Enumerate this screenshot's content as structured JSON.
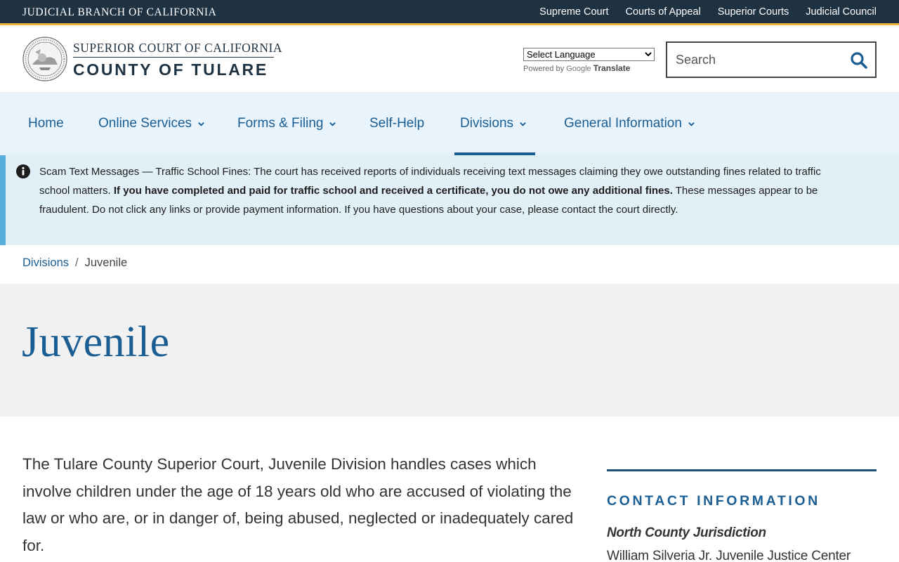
{
  "utility": {
    "branch": "JUDICIAL BRANCH OF CALIFORNIA",
    "links": [
      "Supreme Court",
      "Courts of Appeal",
      "Superior Courts",
      "Judicial Council"
    ]
  },
  "header": {
    "logo_top": "SUPERIOR COURT OF CALIFORNIA",
    "logo_bottom": "COUNTY OF TULARE",
    "translate_select": "Select Language",
    "powered_by": "Powered by",
    "google": "Google",
    "translate": "Translate",
    "search_placeholder": "Search"
  },
  "nav": {
    "items": [
      "Home",
      "Online Services",
      "Forms & Filing",
      "Self-Help",
      "Divisions",
      "General Information"
    ],
    "active": "Divisions"
  },
  "alert": {
    "title": "Scam Text Messages — Traffic School Fines:",
    "text1": " The court has received reports of individuals receiving text messages claiming they owe outstanding fines related to traffic school matters. ",
    "bold": "If you have completed and paid for traffic school and received a certificate, you do not owe any additional fines.",
    "text2": " These messages appear to be fraudulent. Do not click any links or provide payment information. If you have questions about your case, please contact the court directly."
  },
  "breadcrumb": {
    "parent": "Divisions",
    "separator": "/",
    "current": "Juvenile"
  },
  "page": {
    "title": "Juvenile",
    "intro": "The Tulare County Superior Court, Juvenile Division handles cases which involve children under the age of 18 years old who are accused of violating the law or who are, or in danger of, being abused, neglected or inadequately cared for."
  },
  "sidebar": {
    "heading": "CONTACT INFORMATION",
    "jurisdiction": "North County Jurisdiction",
    "center": "William Silveria Jr. Juvenile Justice Center"
  },
  "colors": {
    "navy": "#1f3242",
    "gold": "#e8b53a",
    "link_blue": "#1a5e94",
    "nav_bg": "#e8f3fb",
    "alert_bg": "#e1f0f7",
    "alert_border": "#5aaedb",
    "hero_bg": "#f1f1f1"
  }
}
